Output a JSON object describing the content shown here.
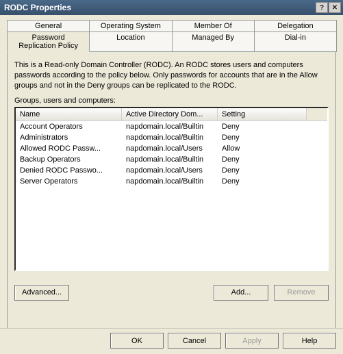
{
  "window": {
    "title": "RODC Properties",
    "help_glyph": "?",
    "close_glyph": "✕"
  },
  "tabs_row1": [
    {
      "label": "General"
    },
    {
      "label": "Operating System"
    },
    {
      "label": "Member Of"
    },
    {
      "label": "Delegation"
    }
  ],
  "tabs_row2": [
    {
      "label": "Password Replication Policy",
      "active": true
    },
    {
      "label": "Location"
    },
    {
      "label": "Managed By"
    },
    {
      "label": "Dial-in"
    }
  ],
  "description": "This is a Read-only Domain Controller (RODC).  An RODC stores users and computers passwords according to the policy below.  Only passwords for accounts that are in the Allow groups and not in the Deny groups can be replicated to the RODC.",
  "list_label": "Groups, users and computers:",
  "columns": [
    "Name",
    "Active Directory Dom...",
    "Setting"
  ],
  "rows": [
    {
      "name": "Account Operators",
      "dom": "napdomain.local/Builtin",
      "setting": "Deny"
    },
    {
      "name": "Administrators",
      "dom": "napdomain.local/Builtin",
      "setting": "Deny"
    },
    {
      "name": "Allowed RODC Passw...",
      "dom": "napdomain.local/Users",
      "setting": "Allow"
    },
    {
      "name": "Backup Operators",
      "dom": "napdomain.local/Builtin",
      "setting": "Deny"
    },
    {
      "name": "Denied RODC Passwo...",
      "dom": "napdomain.local/Users",
      "setting": "Deny"
    },
    {
      "name": "Server Operators",
      "dom": "napdomain.local/Builtin",
      "setting": "Deny"
    }
  ],
  "buttons": {
    "advanced": "Advanced...",
    "add": "Add...",
    "remove": "Remove",
    "ok": "OK",
    "cancel": "Cancel",
    "apply": "Apply",
    "help": "Help"
  }
}
